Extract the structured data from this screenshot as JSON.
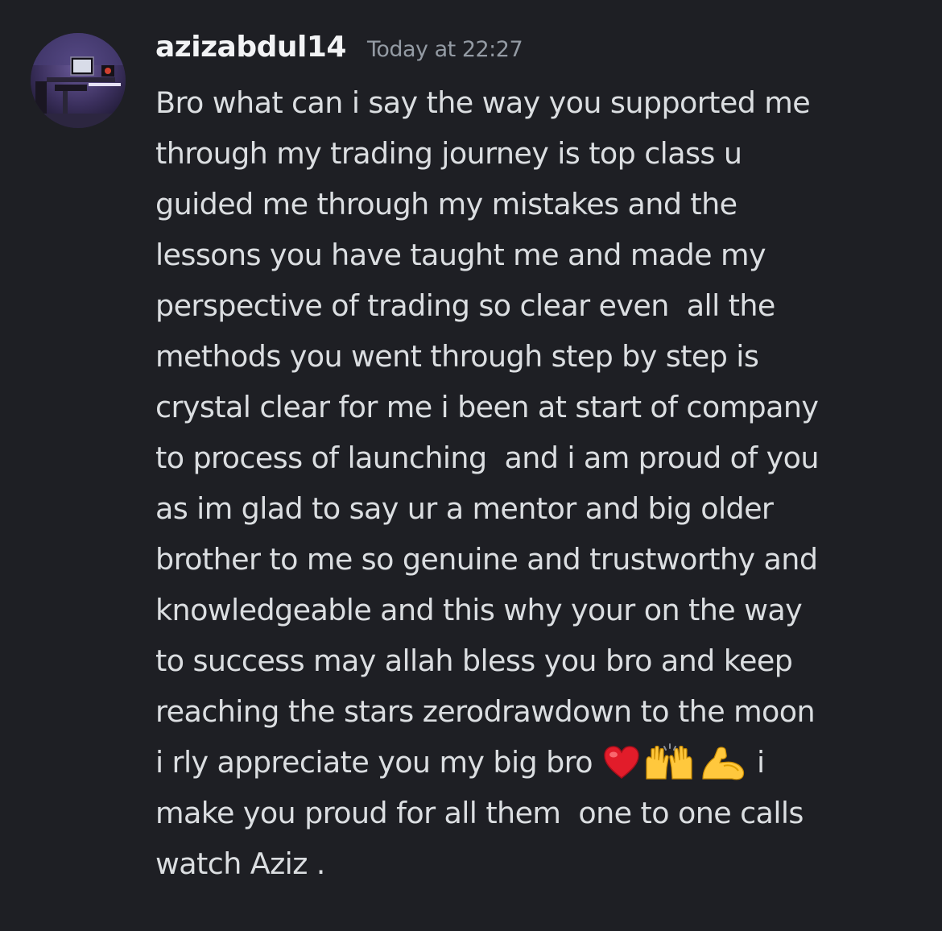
{
  "message": {
    "author": {
      "username": "azizabdul14",
      "avatar_icon": "user-avatar-desk-setup"
    },
    "timestamp": "Today at 22:27",
    "content_lines": [
      "Bro what can i say the way you supported me",
      "through my trading journey is top class u",
      "guided me through my mistakes and the",
      "lessons you have taught me and made my",
      "perspective of trading so clear even  all the",
      "methods you went through step by step is",
      "crystal clear for me i been at start of company",
      "to process of launching  and i am proud of you",
      "as im glad to say ur a mentor and big older",
      "brother to me so genuine and trustworthy and",
      "knowledgeable and this why your on the way",
      "to success may allah bless you bro and keep",
      "reaching the stars zerodrawdown to the moon",
      "i rly appreciate you my big bro ",
      " i",
      "make you proud for all them  one to one calls",
      "watch Aziz ."
    ],
    "emojis": [
      "red-heart-icon",
      "raising-hands-icon",
      "flexed-biceps-icon"
    ],
    "colors": {
      "background": "#1e1f24",
      "username": "#f2f3f5",
      "timestamp": "#949ba4",
      "text": "#dbdee1"
    }
  }
}
